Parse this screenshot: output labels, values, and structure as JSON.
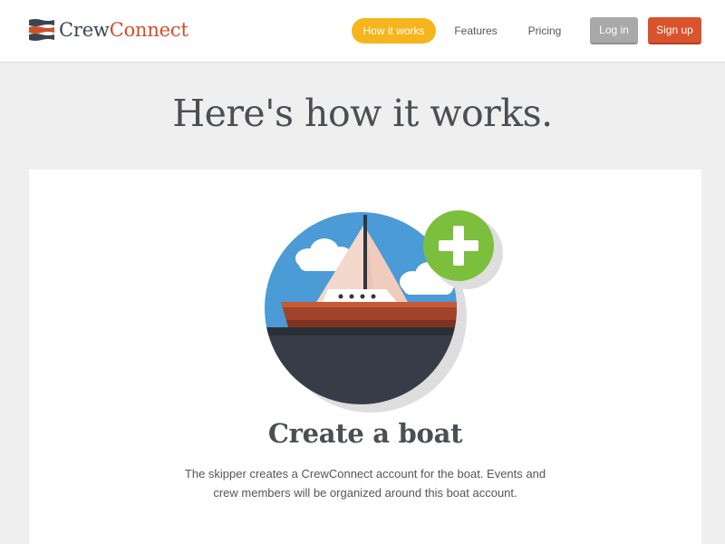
{
  "logo": {
    "part1": "Crew",
    "part2": "Connect"
  },
  "nav": {
    "how_it_works": "How it works",
    "features": "Features",
    "pricing": "Pricing",
    "login": "Log in",
    "signup": "Sign up"
  },
  "main": {
    "title": "Here's how it works.",
    "step": {
      "title": "Create a boat",
      "description": "The skipper creates a CrewConnect account for the boat. Events and crew members will be organized around this boat account."
    }
  },
  "colors": {
    "accent_nav": "#f6b51c",
    "signup_button": "#d9532c",
    "login_button": "#a9a9a9",
    "plus_badge": "#7bbf3c",
    "sky": "#4a9bd6"
  },
  "icons": [
    "logo-mark-icon",
    "plus-icon",
    "sailboat-icon"
  ]
}
